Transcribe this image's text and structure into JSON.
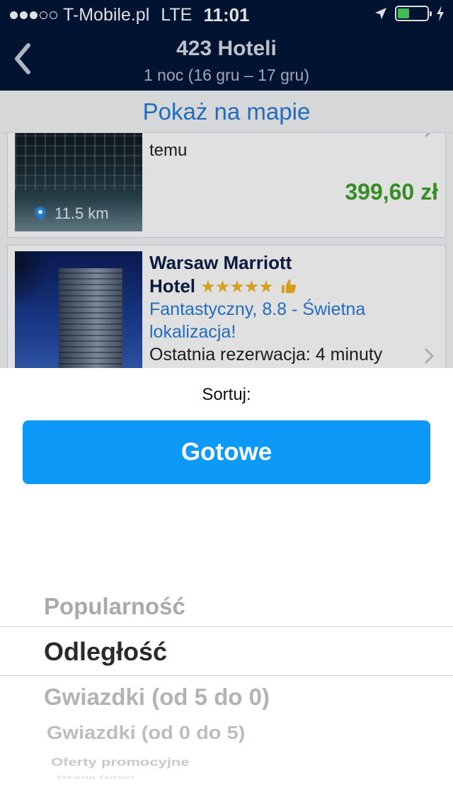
{
  "status_bar": {
    "signal_dots_filled": 3,
    "signal_dots_total": 5,
    "carrier": "T-Mobile.pl",
    "network": "LTE",
    "time": "11:01",
    "battery_level": 0.3,
    "battery_color": "#4cd964",
    "icons": [
      "location-arrow-icon",
      "battery-icon",
      "charging-bolt-icon"
    ]
  },
  "header": {
    "title": "423 Hoteli",
    "subtitle": "1 noc (16 gru – 17 gru)",
    "back_icon": "chevron-left-icon",
    "background": "#001638"
  },
  "map_link": "Pokaż na mapie",
  "hotels": [
    {
      "tail_text": "temu",
      "distance": "11.5 km",
      "price": "399,60 zł"
    },
    {
      "name_line1": "Warsaw Marriott",
      "name_line2": "Hotel",
      "stars": "★★★★★",
      "rating": "Fantastyczny, 8.8 - Świetna lokalizacja!",
      "last_booking": "Ostatnia rezerwacja: 4 minuty"
    }
  ],
  "sheet": {
    "title": "Sortuj:",
    "done_label": "Gotowe",
    "done_color": "#0c99f7",
    "options": [
      "Popularność",
      "Odległość",
      "Gwiazdki (od 5 do 0)",
      "Gwiazdki (od 0 do 5)",
      "Oferty promocyjne",
      "Ocena Gości"
    ],
    "selected_index": 1
  }
}
